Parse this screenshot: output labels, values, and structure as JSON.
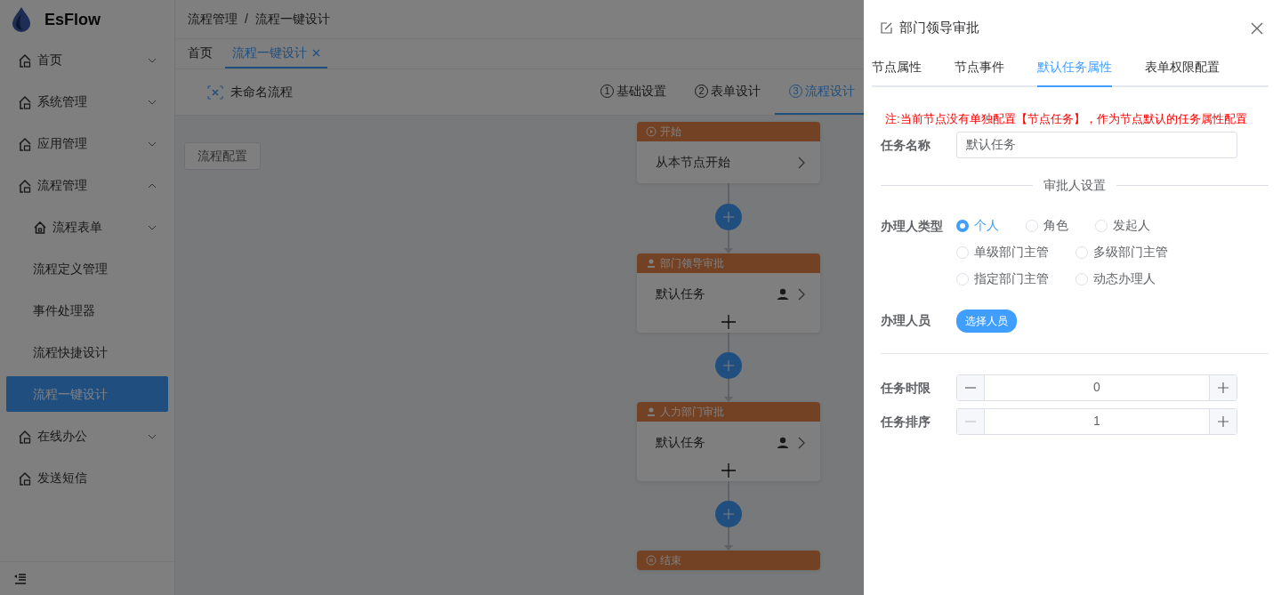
{
  "app": {
    "name": "EsFlow"
  },
  "sidebar": {
    "items": [
      {
        "label": "首页",
        "kind": "group",
        "expanded": false,
        "selected": false
      },
      {
        "label": "系统管理",
        "kind": "group",
        "expanded": false,
        "selected": false
      },
      {
        "label": "应用管理",
        "kind": "group",
        "expanded": false,
        "selected": false
      },
      {
        "label": "流程管理",
        "kind": "group",
        "expanded": true,
        "selected": false,
        "children": [
          {
            "label": "流程表单",
            "kind": "group",
            "expanded": false,
            "selected": false
          },
          {
            "label": "流程定义管理",
            "kind": "link",
            "selected": false
          },
          {
            "label": "事件处理器",
            "kind": "link",
            "selected": false
          },
          {
            "label": "流程快捷设计",
            "kind": "link",
            "selected": false
          },
          {
            "label": "流程一键设计",
            "kind": "link",
            "selected": true
          }
        ]
      },
      {
        "label": "在线办公",
        "kind": "group",
        "expanded": false,
        "selected": false
      },
      {
        "label": "发送短信",
        "kind": "link",
        "selected": false
      }
    ]
  },
  "breadcrumb": {
    "items": [
      "流程管理",
      "流程一键设计"
    ],
    "separator": "/"
  },
  "page_tabs": [
    {
      "label": "首页",
      "selected": false,
      "closable": false
    },
    {
      "label": "流程一键设计",
      "selected": true,
      "closable": true
    }
  ],
  "process": {
    "name": "未命名流程"
  },
  "steps": [
    {
      "number": "1",
      "label": "基础设置",
      "selected": false
    },
    {
      "number": "2",
      "label": "表单设计",
      "selected": false
    },
    {
      "number": "3",
      "label": "流程设计",
      "selected": true
    }
  ],
  "config_button": "流程配置",
  "flow_nodes": [
    {
      "kind": "start",
      "title": "开始",
      "body": "从本节点开始"
    },
    {
      "kind": "approver",
      "title": "部门领导审批",
      "body": "默认任务"
    },
    {
      "kind": "approver",
      "title": "人力部门审批",
      "body": "默认任务"
    },
    {
      "kind": "end",
      "title": "结束"
    }
  ],
  "drawer": {
    "title": "部门领导审批",
    "tabs": [
      {
        "label": "节点属性",
        "selected": false
      },
      {
        "label": "节点事件",
        "selected": false
      },
      {
        "label": "默认任务属性",
        "selected": true
      },
      {
        "label": "表单权限配置",
        "selected": false
      }
    ],
    "note": "注:当前节点没有单独配置【节点任务】，作为节点默认的任务属性配置",
    "task_name": {
      "label": "任务名称",
      "value": "默认任务"
    },
    "section_title": "审批人设置",
    "handler_type": {
      "label": "办理人类型",
      "options": [
        {
          "label": "个人",
          "selected": true
        },
        {
          "label": "角色",
          "selected": false
        },
        {
          "label": "发起人",
          "selected": false
        },
        {
          "label": "单级部门主管",
          "selected": false
        },
        {
          "label": "多级部门主管",
          "selected": false
        },
        {
          "label": "指定部门主管",
          "selected": false
        },
        {
          "label": "动态办理人",
          "selected": false
        }
      ]
    },
    "handler": {
      "label": "办理人员",
      "button": "选择人员"
    },
    "numbers": [
      {
        "label": "任务时限",
        "value": "0",
        "minus_disabled": false
      },
      {
        "label": "任务排序",
        "value": "1",
        "minus_disabled": true
      }
    ]
  }
}
